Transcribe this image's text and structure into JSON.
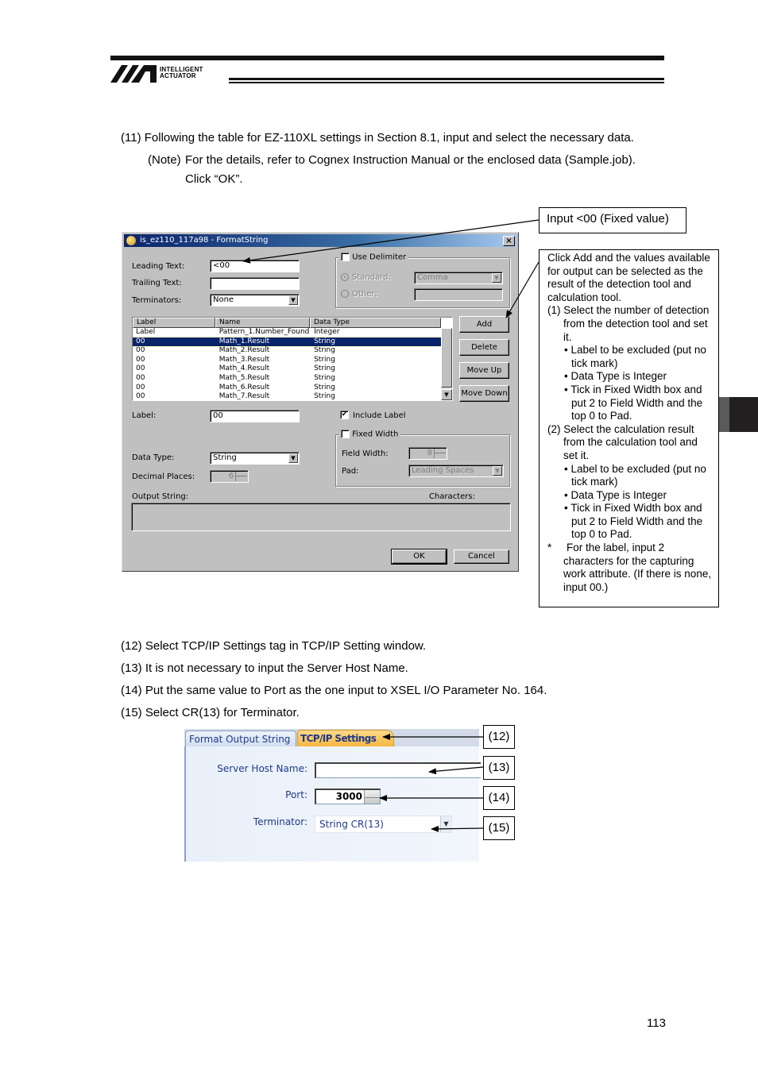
{
  "header": {
    "brand_line1": "INTELLIGENT",
    "brand_line2": "ACTUATOR",
    "logo_icon": "ia-logo-icon"
  },
  "steps_top": {
    "step11": "(11) Following the table for EZ-110XL settings in Section 8.1, input and select the necessary data.",
    "note_label": "(Note)",
    "note_text": "For the details, refer to Cognex Instruction Manual or the enclosed data (Sample.job).",
    "click_ok": "Click “OK”."
  },
  "format_dialog": {
    "title": "is_ez110_117a98 - FormatString",
    "title_icon": "app-icon",
    "close_icon": "close-icon",
    "leading_text_label": "Leading Text:",
    "leading_text_value": "<00",
    "trailing_text_label": "Trailing Text:",
    "trailing_text_value": "",
    "terminators_label": "Terminators:",
    "terminators_value": "None",
    "use_delimiter_label": "Use Delimiter",
    "use_delimiter_checked": false,
    "standard_label": "Standard:",
    "standard_value": "Comma",
    "other_label": "Other:",
    "other_value": "",
    "list": {
      "columns": [
        "Label",
        "Name",
        "Data Type"
      ],
      "rows": [
        {
          "label": "Label",
          "name": "Pattern_1.Number_Found",
          "type": "Integer",
          "selected": false
        },
        {
          "label": "00",
          "name": "Math_1.Result",
          "type": "String",
          "selected": true
        },
        {
          "label": "00",
          "name": "Math_2.Result",
          "type": "String",
          "selected": false
        },
        {
          "label": "00",
          "name": "Math_3.Result",
          "type": "String",
          "selected": false
        },
        {
          "label": "00",
          "name": "Math_4.Result",
          "type": "String",
          "selected": false
        },
        {
          "label": "00",
          "name": "Math_5.Result",
          "type": "String",
          "selected": false
        },
        {
          "label": "00",
          "name": "Math_6.Result",
          "type": "String",
          "selected": false
        },
        {
          "label": "00",
          "name": "Math_7.Result",
          "type": "String",
          "selected": false
        }
      ]
    },
    "buttons": {
      "add": "Add",
      "delete": "Delete",
      "move_up": "Move Up",
      "move_down": "Move Down",
      "ok": "OK",
      "cancel": "Cancel"
    },
    "label_label": "Label:",
    "label_value": "00",
    "include_label_label": "Include Label",
    "include_label_checked": true,
    "fixed_width_label": "Fixed Width",
    "fixed_width_checked": false,
    "field_width_label": "Field Width:",
    "field_width_value": "8",
    "pad_label": "Pad:",
    "pad_value": "Leading Spaces",
    "data_type_label": "Data Type:",
    "data_type_value": "String",
    "decimal_places_label": "Decimal Places:",
    "decimal_places_value": "6",
    "output_string_label": "Output String:",
    "characters_label": "Characters:",
    "output_string_value": ""
  },
  "callouts": {
    "leading_text": "Input <00 (Fixed value)",
    "add_note": {
      "intro": "Click Add and the values available for output can be selected as the result of the detection tool and calculation tool.",
      "item1_num": "(1)",
      "item1_text": "Select the number of detection from the detection tool and set it.",
      "item1_bullets": [
        "• Label to be excluded (put no tick mark)",
        "• Data Type is Integer",
        "• Tick in Fixed Width box and put 2 to Field Width and the top 0 to Pad."
      ],
      "item2_num": "(2)",
      "item2_text": "Select the calculation result from the calculation tool and set it.",
      "item2_bullets": [
        "• Label to be excluded (put no tick mark)",
        "• Data Type is Integer",
        "• Tick in Fixed Width box and put 2 to Field Width and the top 0 to Pad."
      ],
      "star": "*",
      "star_text": "For the label, input 2 characters for the capturing work attribute. (If there is none, input 00.)"
    }
  },
  "steps_bottom": [
    "(12) Select TCP/IP Settings tag in TCP/IP Setting window.",
    "(13) It is not necessary to input the Server Host Name.",
    "(14) Put the same value to Port as the one input to XSEL I/O Parameter No. 164.",
    "(15) Select CR(13) for Terminator."
  ],
  "tcp_panel": {
    "tabs": [
      "Format Output String",
      "TCP/IP Settings"
    ],
    "active_tab": "TCP/IP Settings",
    "server_host_label": "Server Host Name:",
    "server_host_value": "",
    "port_label": "Port:",
    "port_value": "3000",
    "terminator_label": "Terminator:",
    "terminator_value": "String CR(13)"
  },
  "markers": [
    "(12)",
    "(13)",
    "(14)",
    "(15)"
  ],
  "page_number": "113"
}
